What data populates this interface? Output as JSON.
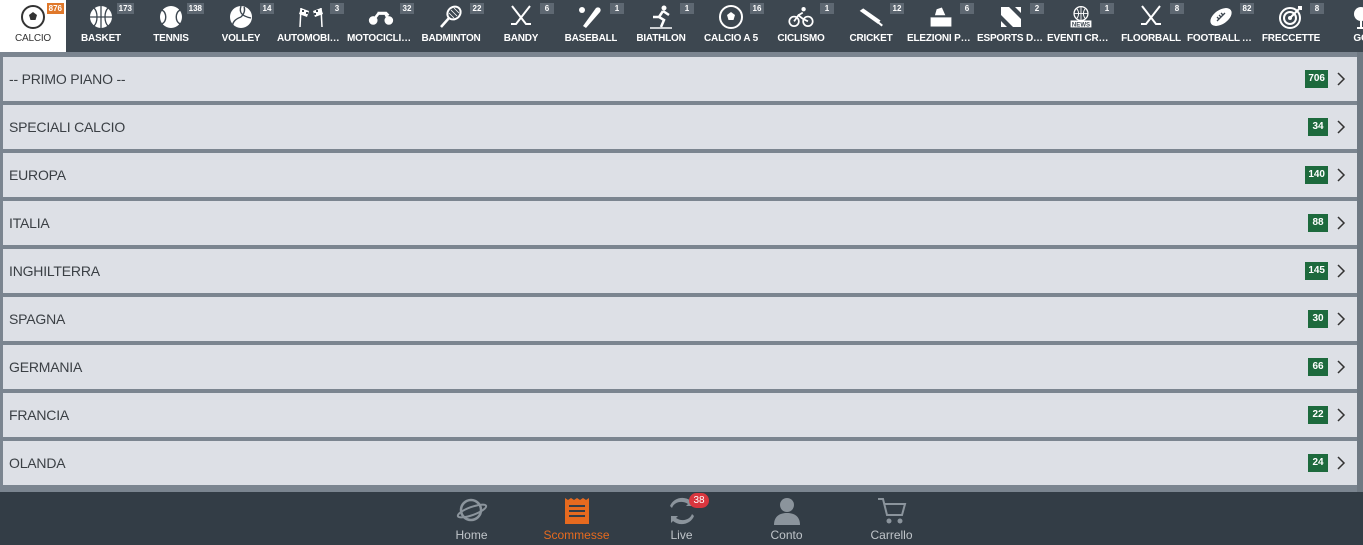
{
  "sports": [
    {
      "label": "CALCIO",
      "count": "876",
      "icon": "soccer-ball-icon",
      "active": true
    },
    {
      "label": "BASKET",
      "count": "173",
      "icon": "basketball-icon"
    },
    {
      "label": "TENNIS",
      "count": "138",
      "icon": "tennis-ball-icon"
    },
    {
      "label": "VOLLEY",
      "count": "14",
      "icon": "volleyball-icon"
    },
    {
      "label": "AUTOMOBILIS...",
      "count": "3",
      "icon": "checkered-flags-icon"
    },
    {
      "label": "MOTOCICLISM...",
      "count": "32",
      "icon": "motorbike-icon"
    },
    {
      "label": "BADMINTON",
      "count": "22",
      "icon": "badminton-racket-icon"
    },
    {
      "label": "BANDY",
      "count": "6",
      "icon": "crossed-sticks-icon"
    },
    {
      "label": "BASEBALL",
      "count": "1",
      "icon": "baseball-bat-icon"
    },
    {
      "label": "BIATHLON",
      "count": "1",
      "icon": "biathlon-icon"
    },
    {
      "label": "CALCIO A 5",
      "count": "16",
      "icon": "futsal-ball-icon"
    },
    {
      "label": "CICLISMO",
      "count": "1",
      "icon": "cyclist-icon"
    },
    {
      "label": "CRICKET",
      "count": "12",
      "icon": "cricket-bat-icon"
    },
    {
      "label": "ELEZIONI POLI...",
      "count": "6",
      "icon": "ballot-box-icon"
    },
    {
      "label": "ESPORTS DOT...",
      "count": "2",
      "icon": "dota-icon"
    },
    {
      "label": "EVENTI CRON...",
      "count": "1",
      "icon": "news-globe-icon"
    },
    {
      "label": "FLOORBALL",
      "count": "8",
      "icon": "crossed-sticks-icon"
    },
    {
      "label": "FOOTBALL AM...",
      "count": "82",
      "icon": "american-football-icon"
    },
    {
      "label": "FRECCETTE",
      "count": "8",
      "icon": "dartboard-icon"
    },
    {
      "label": "GO",
      "count": "",
      "icon": "golf-icon"
    }
  ],
  "leagues": [
    {
      "name": "-- PRIMO PIANO --",
      "count": "706"
    },
    {
      "name": "SPECIALI CALCIO",
      "count": "34"
    },
    {
      "name": "EUROPA",
      "count": "140"
    },
    {
      "name": "ITALIA",
      "count": "88"
    },
    {
      "name": "INGHILTERRA",
      "count": "145"
    },
    {
      "name": "SPAGNA",
      "count": "30"
    },
    {
      "name": "GERMANIA",
      "count": "66"
    },
    {
      "name": "FRANCIA",
      "count": "22"
    },
    {
      "name": "OLANDA",
      "count": "24"
    }
  ],
  "bottom_nav": [
    {
      "label": "Home",
      "icon": "home-planet-icon"
    },
    {
      "label": "Scommesse",
      "icon": "betting-slip-icon",
      "active": true
    },
    {
      "label": "Live",
      "icon": "live-arrows-icon",
      "badge": "38"
    },
    {
      "label": "Conto",
      "icon": "user-account-icon"
    },
    {
      "label": "Carrello",
      "icon": "shopping-cart-icon"
    }
  ],
  "colors": {
    "top_bar": "#3d4750",
    "row_bg": "#dde0e6",
    "count_badge": "#1d6a3d",
    "accent": "#e66a1f",
    "active_sport_count": "#e0782a",
    "live_badge": "#d9363e"
  }
}
